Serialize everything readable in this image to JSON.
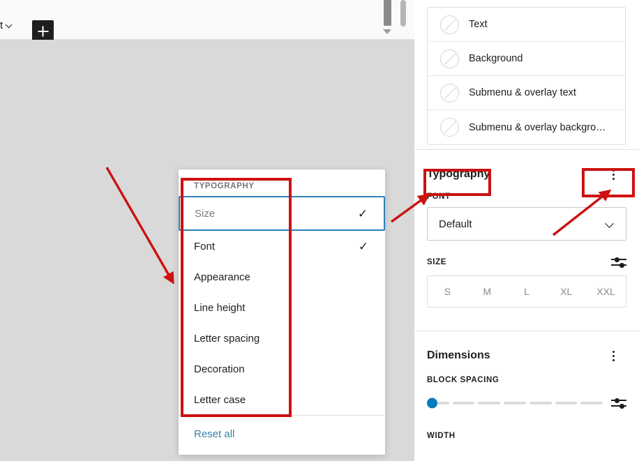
{
  "app": {
    "editor_breadcrumb": "t",
    "add_block_label": "+"
  },
  "topbar": {
    "breadcrumb_text": "t",
    "chevron_icon": "chevron-down-icon",
    "add_block_icon": "plus-icon"
  },
  "popover": {
    "heading": "TYPOGRAPHY",
    "items": [
      {
        "label": "Size",
        "checked": true,
        "focused": true
      },
      {
        "label": "Font",
        "checked": true,
        "focused": false
      },
      {
        "label": "Appearance",
        "checked": false,
        "focused": false
      },
      {
        "label": "Line height",
        "checked": false,
        "focused": false
      },
      {
        "label": "Letter spacing",
        "checked": false,
        "focused": false
      },
      {
        "label": "Decoration",
        "checked": false,
        "focused": false
      },
      {
        "label": "Letter case",
        "checked": false,
        "focused": false
      }
    ],
    "check_glyph": "✓",
    "reset_all_label": "Reset all",
    "focus_ring_color": "#2e82b8",
    "reset_link_color": "#3b7fa6"
  },
  "sidebar": {
    "color_rows": [
      {
        "label": "Text",
        "swatch": "empty-swatch-icon"
      },
      {
        "label": "Background",
        "swatch": "empty-swatch-icon"
      },
      {
        "label": "Submenu & overlay text",
        "swatch": "empty-swatch-icon"
      },
      {
        "label": "Submenu & overlay backgro…",
        "swatch": "empty-swatch-icon"
      }
    ],
    "typography": {
      "title": "Typography",
      "kebab_icon": "more-options-icon",
      "font_label": "FONT",
      "font_value": "Default",
      "font_chevron_icon": "chevron-down-icon",
      "size_label": "SIZE",
      "size_tools_icon": "sliders-icon",
      "size_options": [
        "S",
        "M",
        "L",
        "XL",
        "XXL"
      ]
    },
    "dimensions": {
      "title": "Dimensions",
      "kebab_icon": "more-options-icon",
      "block_spacing_label": "BLOCK SPACING",
      "block_spacing_value": 0,
      "block_spacing_steps": 7,
      "block_spacing_tools_icon": "sliders-icon",
      "width_label": "WIDTH",
      "thumb_color": "#007cba"
    }
  },
  "annotations": {
    "color": "#cc1111",
    "boxes": [
      {
        "name": "typography-tools-menu-highlight"
      },
      {
        "name": "typography-section-title-highlight"
      },
      {
        "name": "typography-kebab-highlight"
      }
    ],
    "arrows": [
      {
        "name": "arrow-to-tools-menu"
      },
      {
        "name": "arrow-to-typography-title"
      },
      {
        "name": "arrow-to-kebab-menu"
      }
    ]
  }
}
